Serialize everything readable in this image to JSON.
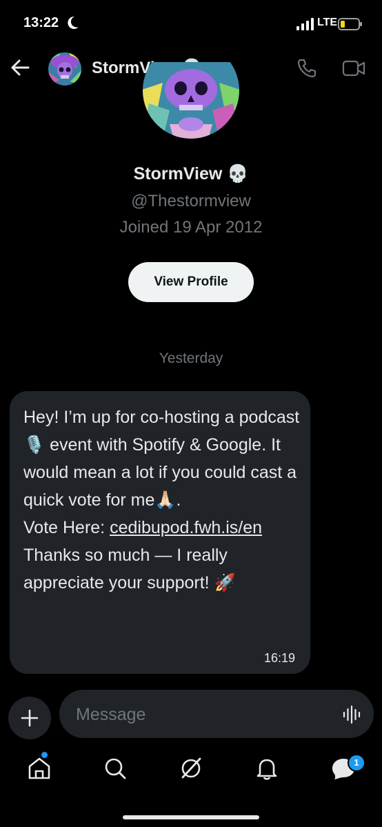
{
  "status_bar": {
    "time": "13:22",
    "network": "LTE"
  },
  "header": {
    "name": "StormView",
    "emoji": "💀"
  },
  "profile": {
    "name": "StormView",
    "emoji": "💀",
    "handle": "@Thestormview",
    "joined": "Joined 19 Apr 2012",
    "view_profile_label": "View Profile"
  },
  "conversation": {
    "date_separator": "Yesterday",
    "message": {
      "line1": "Hey! I’m up for co-hosting a podcast 🎙️ event with Spotify & Google. It would mean a lot if you could cast a quick vote for me🙏🏻.",
      "vote_prefix": "Vote Here: ",
      "link": "cedibupod.fwh.is/en",
      "line3": "Thanks so much — I really appreciate your support! 🚀",
      "time": "16:19"
    }
  },
  "composer": {
    "placeholder": "Message"
  },
  "tabbar": {
    "messages_badge": "1"
  },
  "colors": {
    "accent": "#1d9bf0",
    "bubble": "#202327",
    "muted": "#71767b"
  }
}
